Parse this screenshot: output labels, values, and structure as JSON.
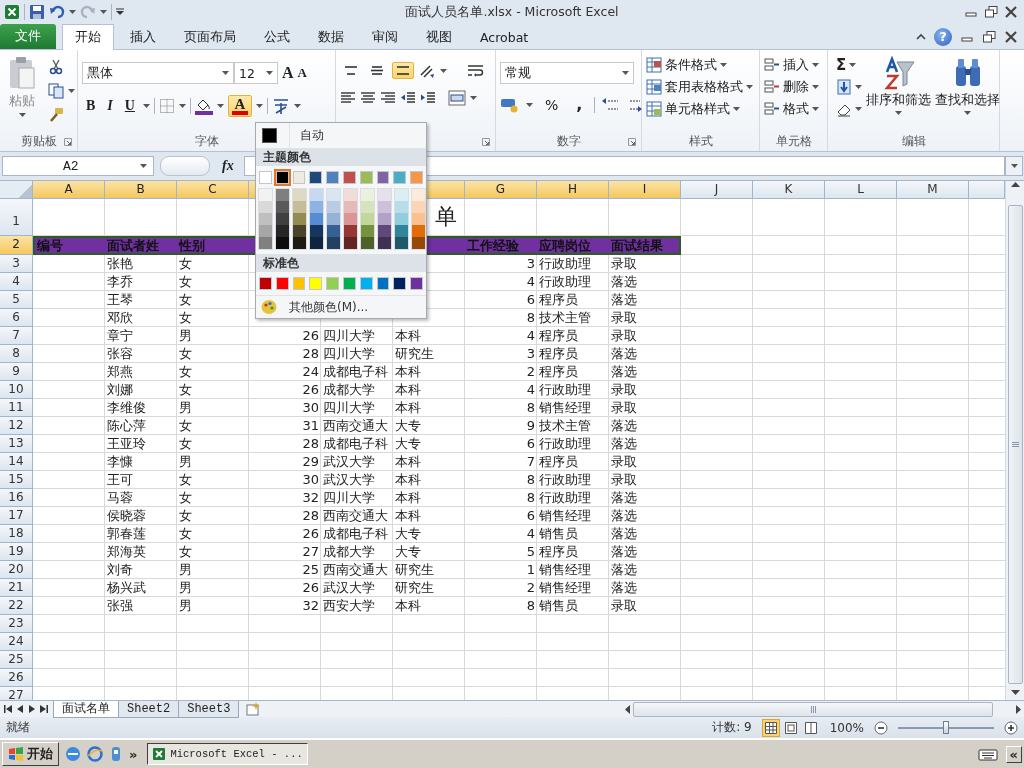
{
  "title_bar": {
    "title": "面试人员名单.xlsx - Microsoft Excel"
  },
  "ribbon_tabs": [
    {
      "label": "文件",
      "kind": "file",
      "selected": false
    },
    {
      "label": "开始",
      "kind": "tab",
      "selected": true
    },
    {
      "label": "插入",
      "kind": "tab",
      "selected": false
    },
    {
      "label": "页面布局",
      "kind": "tab",
      "selected": false
    },
    {
      "label": "公式",
      "kind": "tab",
      "selected": false
    },
    {
      "label": "数据",
      "kind": "tab",
      "selected": false
    },
    {
      "label": "审阅",
      "kind": "tab",
      "selected": false
    },
    {
      "label": "视图",
      "kind": "tab",
      "selected": false
    },
    {
      "label": "Acrobat",
      "kind": "tab",
      "selected": false
    }
  ],
  "help": "?",
  "ribbon": {
    "clipboard": {
      "paste": "粘贴",
      "label": "剪贴板"
    },
    "font": {
      "name": "黑体",
      "size": "12",
      "grow": "A",
      "shrink": "A",
      "bold": "B",
      "italic": "I",
      "underline": "U",
      "color_button": {
        "label": "A",
        "open": true
      },
      "label": "字体"
    },
    "alignment": {
      "vertical": [
        {
          "selected": false
        },
        {
          "selected": false
        },
        {
          "selected": true
        }
      ]
    },
    "number": {
      "format": "常规",
      "percent": "%",
      "comma": ",",
      "label": "数字"
    },
    "styles": {
      "items": [
        "条件格式",
        "套用表格格式",
        "单元格样式"
      ],
      "label": "样式"
    },
    "cells": {
      "items": [
        "插入",
        "删除",
        "格式"
      ],
      "label": "单元格"
    },
    "editing": {
      "sum": "Σ",
      "sort": "排序和筛选",
      "find": "查找和选择",
      "label": "编辑"
    }
  },
  "formula_bar": {
    "name_box": "A2",
    "fx": "fx"
  },
  "column_headers": [
    {
      "label": "A",
      "selected": true
    },
    {
      "label": "B",
      "selected": true
    },
    {
      "label": "C",
      "selected": true
    },
    {
      "selected": true
    },
    {
      "selected": true
    },
    {
      "label": "G",
      "selected": true
    },
    {
      "label": "H",
      "selected": true
    },
    {
      "label": "I",
      "selected": true
    },
    {
      "label": "J",
      "selected": false
    },
    {
      "label": "K",
      "selected": false
    },
    {
      "label": "L",
      "selected": false
    },
    {
      "label": "M",
      "selected": false
    },
    {
      "selected": false
    }
  ],
  "rows": [
    {
      "number": "1",
      "selected": false,
      "kind": "title",
      "title": "单"
    },
    {
      "number": "2",
      "selected": true,
      "kind": "header",
      "a": "编号",
      "b": "面试者姓",
      "c": "性别",
      "g": "工作经验",
      "h": "应聘岗位",
      "i": "面试结果"
    },
    {
      "number": "3",
      "selected": false,
      "kind": "data",
      "b": "张艳",
      "c": "女",
      "g": "3",
      "h": "行政助理",
      "i": "录取"
    },
    {
      "number": "4",
      "selected": false,
      "kind": "data",
      "b": "李乔",
      "c": "女",
      "g": "4",
      "h": "行政助理",
      "i": "落选"
    },
    {
      "number": "5",
      "selected": false,
      "kind": "data",
      "b": "王琴",
      "c": "女",
      "g": "6",
      "h": "程序员",
      "i": "落选"
    },
    {
      "number": "6",
      "selected": false,
      "kind": "data",
      "b": "邓欣",
      "c": "女",
      "g": "8",
      "h": "技术主管",
      "i": "录取"
    },
    {
      "number": "7",
      "selected": false,
      "kind": "data",
      "b": "章宁",
      "c": "男",
      "d": "26",
      "e": "四川大学",
      "f": "本科",
      "g": "4",
      "h": "程序员",
      "i": "录取"
    },
    {
      "number": "8",
      "selected": false,
      "kind": "data",
      "b": "张容",
      "c": "女",
      "d": "28",
      "e": "四川大学",
      "f": "研究生",
      "g": "3",
      "h": "程序员",
      "i": "落选"
    },
    {
      "number": "9",
      "selected": false,
      "kind": "data",
      "b": "郑燕",
      "c": "女",
      "d": "24",
      "e": "成都电子科",
      "f": "本科",
      "g": "2",
      "h": "程序员",
      "i": "落选"
    },
    {
      "number": "10",
      "selected": false,
      "kind": "data",
      "b": "刘娜",
      "c": "女",
      "d": "26",
      "e": "成都大学",
      "f": "本科",
      "g": "4",
      "h": "行政助理",
      "i": "录取"
    },
    {
      "number": "11",
      "selected": false,
      "kind": "data",
      "b": "李维俊",
      "c": "男",
      "d": "30",
      "e": "四川大学",
      "f": "本科",
      "g": "8",
      "h": "销售经理",
      "i": "录取"
    },
    {
      "number": "12",
      "selected": false,
      "kind": "data",
      "b": "陈心萍",
      "c": "女",
      "d": "31",
      "e": "西南交通大",
      "f": "大专",
      "g": "9",
      "h": "技术主管",
      "i": "落选"
    },
    {
      "number": "13",
      "selected": false,
      "kind": "data",
      "b": "王亚玲",
      "c": "女",
      "d": "28",
      "e": "成都电子科",
      "f": "大专",
      "g": "6",
      "h": "行政助理",
      "i": "落选"
    },
    {
      "number": "14",
      "selected": false,
      "kind": "data",
      "b": "李慷",
      "c": "男",
      "d": "29",
      "e": "武汉大学",
      "f": "本科",
      "g": "7",
      "h": "程序员",
      "i": "录取"
    },
    {
      "number": "15",
      "selected": false,
      "kind": "data",
      "b": "王可",
      "c": "女",
      "d": "30",
      "e": "武汉大学",
      "f": "本科",
      "g": "8",
      "h": "行政助理",
      "i": "录取"
    },
    {
      "number": "16",
      "selected": false,
      "kind": "data",
      "b": "马蓉",
      "c": "女",
      "d": "32",
      "e": "四川大学",
      "f": "本科",
      "g": "8",
      "h": "行政助理",
      "i": "落选"
    },
    {
      "number": "17",
      "selected": false,
      "kind": "data",
      "b": "侯晓蓉",
      "c": "女",
      "d": "28",
      "e": "西南交通大",
      "f": "本科",
      "g": "6",
      "h": "销售经理",
      "i": "落选"
    },
    {
      "number": "18",
      "selected": false,
      "kind": "data",
      "b": "郭春莲",
      "c": "女",
      "d": "26",
      "e": "成都电子科",
      "f": "大专",
      "g": "4",
      "h": "销售员",
      "i": "落选"
    },
    {
      "number": "19",
      "selected": false,
      "kind": "data",
      "b": "郑海英",
      "c": "女",
      "d": "27",
      "e": "成都大学",
      "f": "大专",
      "g": "5",
      "h": "程序员",
      "i": "落选"
    },
    {
      "number": "20",
      "selected": false,
      "kind": "data",
      "b": "刘奇",
      "c": "男",
      "d": "25",
      "e": "西南交通大",
      "f": "研究生",
      "g": "1",
      "h": "销售经理",
      "i": "落选"
    },
    {
      "number": "21",
      "selected": false,
      "kind": "data",
      "b": "杨兴武",
      "c": "男",
      "d": "26",
      "e": "武汉大学",
      "f": "研究生",
      "g": "2",
      "h": "销售经理",
      "i": "落选"
    },
    {
      "number": "22",
      "selected": false,
      "kind": "data",
      "b": "张强",
      "c": "男",
      "d": "32",
      "e": "西安大学",
      "f": "本科",
      "g": "8",
      "h": "销售员",
      "i": "录取"
    },
    {
      "number": "23",
      "selected": false,
      "kind": "data"
    },
    {
      "number": "24",
      "selected": false,
      "kind": "data"
    },
    {
      "number": "25",
      "selected": false,
      "kind": "data"
    },
    {
      "number": "26",
      "selected": false,
      "kind": "data"
    },
    {
      "number": "27",
      "selected": false,
      "kind": "data"
    }
  ],
  "sheet_tabs": [
    {
      "label": "面试名单",
      "selected": true
    },
    {
      "label": "Sheet2",
      "selected": false
    },
    {
      "label": "Sheet3",
      "selected": false
    }
  ],
  "status_bar": {
    "ready": "就绪",
    "count": "计数: 9",
    "zoom": "100%",
    "zoom_slider": {
      "level": 0.5
    }
  },
  "taskbar": {
    "start": "开始",
    "more": "»",
    "window": "Microsoft Excel - ...",
    "tray_more": "«"
  },
  "color_menu": {
    "automatic": "自动",
    "theme_title": "主题颜色",
    "theme": [
      {
        "color": "#ffffff",
        "selected": false,
        "shades": [
          {
            "color": "#f2f2f2"
          },
          {
            "color": "#d9d9d9"
          },
          {
            "color": "#bfbfbf"
          },
          {
            "color": "#a6a6a6"
          },
          {
            "color": "#808080"
          }
        ]
      },
      {
        "color": "#000000",
        "selected": true,
        "shades": [
          {
            "color": "#7f7f7f"
          },
          {
            "color": "#595959"
          },
          {
            "color": "#404040"
          },
          {
            "color": "#262626"
          },
          {
            "color": "#0d0d0d"
          }
        ]
      },
      {
        "color": "#eeece1",
        "selected": false,
        "shades": [
          {
            "color": "#ddd9c3"
          },
          {
            "color": "#c4bd97"
          },
          {
            "color": "#948a54"
          },
          {
            "color": "#4a452a"
          },
          {
            "color": "#1e1c11"
          }
        ]
      },
      {
        "color": "#1f497d",
        "selected": false,
        "shades": [
          {
            "color": "#c6d9f0"
          },
          {
            "color": "#8db3e2"
          },
          {
            "color": "#548dd4"
          },
          {
            "color": "#17365d"
          },
          {
            "color": "#0f243e"
          }
        ]
      },
      {
        "color": "#4f81bd",
        "selected": false,
        "shades": [
          {
            "color": "#dbe5f1"
          },
          {
            "color": "#b8cce4"
          },
          {
            "color": "#95b3d7"
          },
          {
            "color": "#366092"
          },
          {
            "color": "#244061"
          }
        ]
      },
      {
        "color": "#c0504d",
        "selected": false,
        "shades": [
          {
            "color": "#f2dcdb"
          },
          {
            "color": "#e5b9b7"
          },
          {
            "color": "#d99694"
          },
          {
            "color": "#953734"
          },
          {
            "color": "#632423"
          }
        ]
      },
      {
        "color": "#9bbb59",
        "selected": false,
        "shades": [
          {
            "color": "#ebf1dd"
          },
          {
            "color": "#d7e3bc"
          },
          {
            "color": "#c3d69b"
          },
          {
            "color": "#76923c"
          },
          {
            "color": "#4f6128"
          }
        ]
      },
      {
        "color": "#8064a2",
        "selected": false,
        "shades": [
          {
            "color": "#e5e0ec"
          },
          {
            "color": "#ccc1d9"
          },
          {
            "color": "#b2a2c7"
          },
          {
            "color": "#5f497a"
          },
          {
            "color": "#3f3151"
          }
        ]
      },
      {
        "color": "#4bacc6",
        "selected": false,
        "shades": [
          {
            "color": "#dbeef3"
          },
          {
            "color": "#b7dde8"
          },
          {
            "color": "#92cddc"
          },
          {
            "color": "#31859b"
          },
          {
            "color": "#205867"
          }
        ]
      },
      {
        "color": "#f79646",
        "selected": false,
        "shades": [
          {
            "color": "#fdeada"
          },
          {
            "color": "#fbd5b5"
          },
          {
            "color": "#fac08f"
          },
          {
            "color": "#e36c09"
          },
          {
            "color": "#974806"
          }
        ]
      }
    ],
    "standard_title": "标准色",
    "standard": [
      {
        "color": "#c00000"
      },
      {
        "color": "#ff0000"
      },
      {
        "color": "#ffc000"
      },
      {
        "color": "#ffff00"
      },
      {
        "color": "#92d050"
      },
      {
        "color": "#00b050"
      },
      {
        "color": "#00b0f0"
      },
      {
        "color": "#0070c0"
      },
      {
        "color": "#002060"
      },
      {
        "color": "#7030a0"
      }
    ],
    "more": "其他颜色(M)..."
  }
}
